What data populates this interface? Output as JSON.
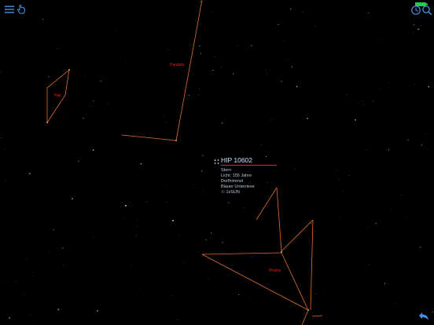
{
  "toolbar": {
    "left_icons": [
      "menu-icon",
      "hand-pointer-icon"
    ],
    "right_icons": [
      "clock-icon",
      "search-icon"
    ],
    "battery_color": "#22cc44"
  },
  "constellations": {
    "left_label": "Hak",
    "top_label": "Pandalo",
    "bottom_label": "Phalos"
  },
  "selected_star": {
    "name": "HIP 10602",
    "type": "Stern",
    "distance": "Licht: 155 Jahre",
    "location": "Dorfhimmel",
    "class": "Blauer Unterriese",
    "magnitude": "☉ 1xSUN"
  },
  "colors": {
    "background": "#000000",
    "constellation_line": "#e0702a",
    "constellation_label": "#e8201c",
    "ui_icon": "#4a90e2",
    "star_name": "#c8e0ff",
    "underline": "#e02020"
  },
  "bottom_right_icon": "back-arrow-icon"
}
